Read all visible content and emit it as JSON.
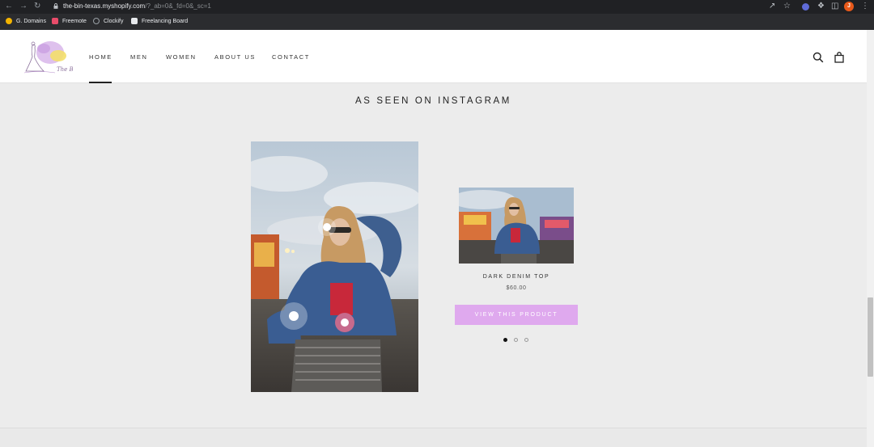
{
  "browser": {
    "url_host": "the-bin-texas.myshopify.com",
    "url_rest": "/?_ab=0&_fd=0&_sc=1",
    "profile_initial": "J"
  },
  "bookmarks": [
    {
      "label": "G. Domains",
      "color": "#f4b400"
    },
    {
      "label": "Freemote",
      "color": "#e94c6a"
    },
    {
      "label": "Clockify",
      "color": "#9aa0a6"
    },
    {
      "label": "Freelancing Board",
      "color": "#e8eaed"
    }
  ],
  "header": {
    "logo_text": "The Bin",
    "nav": [
      "HOME",
      "MEN",
      "WOMEN",
      "ABOUT US",
      "CONTACT"
    ],
    "active_nav": "HOME"
  },
  "main": {
    "section_title": "AS SEEN ON INSTAGRAM",
    "product": {
      "name": "DARK DENIM TOP",
      "price": "$60.00",
      "button_label": "VIEW THIS PRODUCT"
    },
    "carousel_count": 3,
    "carousel_active": 1
  },
  "colors": {
    "accent_button": "#dfa9ee",
    "hotspot_active": "#c76a8c"
  }
}
